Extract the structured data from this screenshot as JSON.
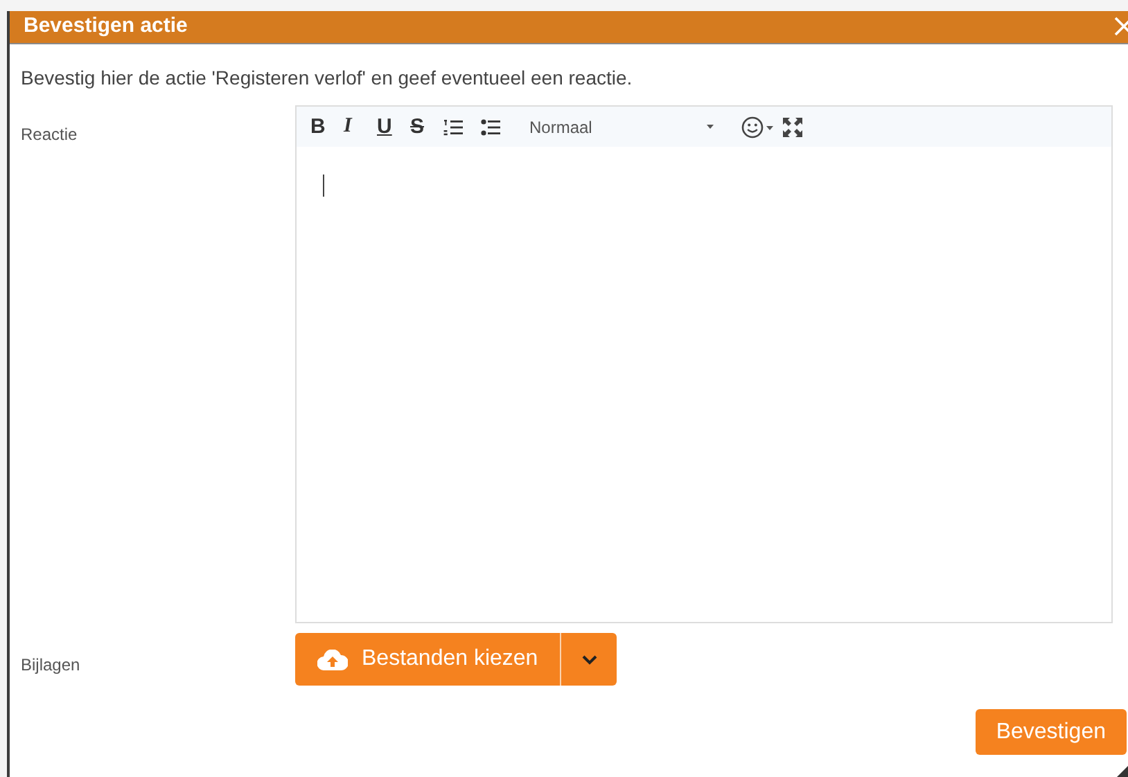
{
  "dialog": {
    "title": "Bevestigen actie",
    "description": "Bevestig hier de actie 'Registeren verlof' en geef eventueel een reactie."
  },
  "reactie": {
    "label": "Reactie",
    "toolbar": [
      "B",
      "I",
      "U",
      "S"
    ],
    "format": "Normaal"
  },
  "bijlagen": {
    "label": "Bijlagen",
    "upload_button": "Bestanden kiezen"
  },
  "confirm_button": "Bevestigen"
}
